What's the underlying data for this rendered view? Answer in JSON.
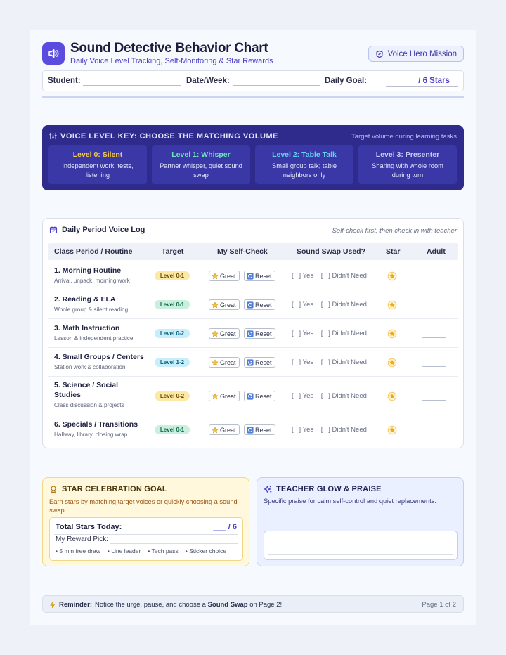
{
  "header": {
    "title": "Sound Detective Behavior Chart",
    "subtitle": "Daily Voice Level Tracking, Self-Monitoring & Star Rewards",
    "mission_label": "Voice Hero Mission",
    "logo_icon": "speaker-icon"
  },
  "info": {
    "student_label": "Student:",
    "date_label": "Date/Week:",
    "goal_label": "Daily Goal:",
    "goal_value": "_____ / 6 Stars"
  },
  "voice_key": {
    "title": "VOICE LEVEL KEY: CHOOSE THE MATCHING VOLUME",
    "note": "Target volume during learning tasks",
    "levels": [
      {
        "label": "Level 0: Silent",
        "desc": "Independent work, tests, listening",
        "color": "#f7cf4a"
      },
      {
        "label": "Level 1: Whisper",
        "desc": "Partner whisper, quiet sound swap",
        "color": "#6fe3c0"
      },
      {
        "label": "Level 2: Table Talk",
        "desc": "Small group talk; table neighbors only",
        "color": "#62d6ee"
      },
      {
        "label": "Level 3: Presenter",
        "desc": "Sharing with whole room during turn",
        "color": "#c7cdf5"
      }
    ]
  },
  "log": {
    "title": "Daily Period Voice Log",
    "note": "Self-check first, then check in with teacher",
    "columns": [
      "Class Period / Routine",
      "Target",
      "My Self-Check",
      "Sound Swap Used?",
      "Star",
      "Adult"
    ],
    "great_label": "Great",
    "reset_label": "Reset",
    "swap_text": "[   ] Yes    [   ] Didn't Need",
    "rows": [
      {
        "name": "1. Morning Routine",
        "sub": "Arrival, unpack, morning work",
        "target": "Level 0-1",
        "tone": "yellow"
      },
      {
        "name": "2. Reading & ELA",
        "sub": "Whole group & silent reading",
        "target": "Level 0-1",
        "tone": "green"
      },
      {
        "name": "3. Math Instruction",
        "sub": "Lesson & independent practice",
        "target": "Level 0-2",
        "tone": "cyan"
      },
      {
        "name": "4. Small Groups / Centers",
        "sub": "Station work & collaboration",
        "target": "Level 1-2",
        "tone": "cyan"
      },
      {
        "name": "5. Science / Social Studies",
        "sub": "Class discussion & projects",
        "target": "Level 0-2",
        "tone": "yellow"
      },
      {
        "name": "6. Specials / Transitions",
        "sub": "Hallway, library, closing wrap",
        "target": "Level 0-1",
        "tone": "green"
      }
    ]
  },
  "celebration": {
    "title": "STAR CELEBRATION GOAL",
    "desc": "Earn stars by matching target voices or quickly choosing a sound swap.",
    "total_label": "Total Stars Today:",
    "total_value": "___ / 6",
    "pick_label": "My Reward Pick:",
    "options": [
      "• 5 min free draw",
      "• Line leader",
      "• Tech pass",
      "• Sticker choice"
    ]
  },
  "praise": {
    "title": "TEACHER GLOW & PRAISE",
    "desc": "Specific praise for calm self-control and quiet replacements."
  },
  "reminder": {
    "label": "Reminder:",
    "text_before": "Notice the urge, pause, and choose a ",
    "text_bold": "Sound Swap",
    "text_after": " on Page 2!",
    "page": "Page 1 of 2"
  }
}
